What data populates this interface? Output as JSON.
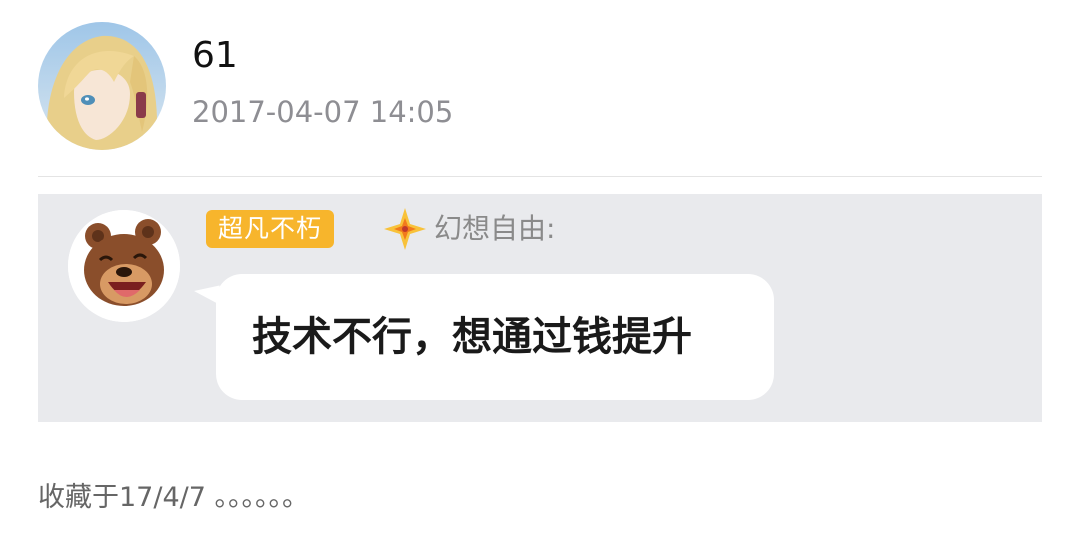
{
  "post": {
    "username": "61",
    "timestamp": "2017-04-07 14:05"
  },
  "quote": {
    "title_badge": "超凡不朽",
    "sender_name": "幻想自由:",
    "message": "技术不行，想通过钱提升"
  },
  "note": "收藏于17/4/7 。。。。。。",
  "colors": {
    "badge": "#f7b52c",
    "card_bg": "#e9eaed",
    "timestamp": "#8e8e93"
  }
}
